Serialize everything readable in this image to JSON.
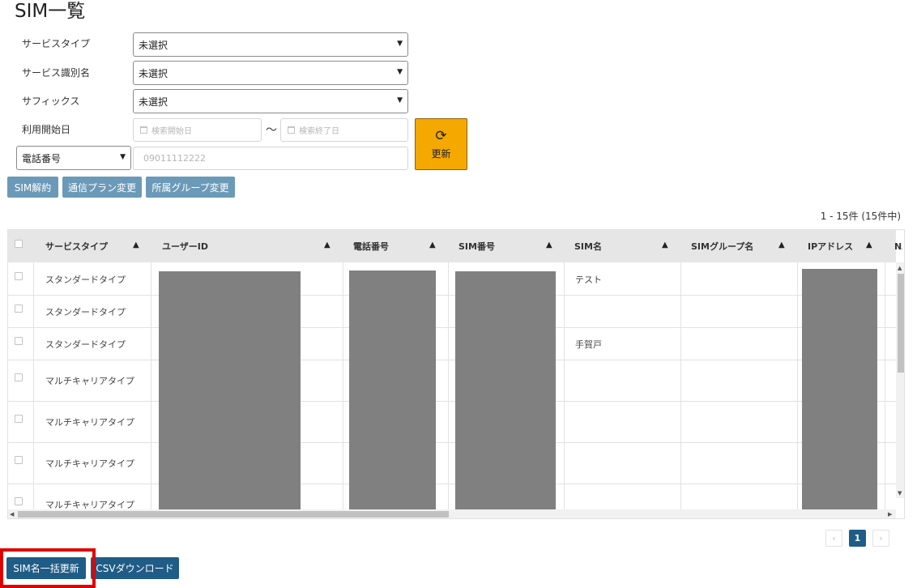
{
  "page_title": "SIM一覧",
  "filters": {
    "service_type": {
      "label": "サービスタイプ",
      "value": "未選択"
    },
    "service_id_name": {
      "label": "サービス識別名",
      "value": "未選択"
    },
    "suffix": {
      "label": "サフィックス",
      "value": "未選択"
    },
    "start_date": {
      "label": "利用開始日",
      "from_placeholder": "検索開始日",
      "separator": "～",
      "to_placeholder": "検索終了日"
    },
    "search_field": {
      "value": "電話番号",
      "placeholder": "09011112222"
    },
    "refresh_label": "更新"
  },
  "actions": {
    "sim_cancel": "SIM解約",
    "plan_change": "通信プラン変更",
    "group_change": "所属グループ変更"
  },
  "count_text": "1 - 15件 (15件中)",
  "table": {
    "headers": [
      "サービスタイプ",
      "ユーザーID",
      "電話番号",
      "SIM番号",
      "SIM名",
      "SIMグループ名",
      "IPアドレス",
      "NA"
    ],
    "rows": [
      {
        "service_type": "スタンダードタイプ",
        "sim_name": "テスト"
      },
      {
        "service_type": "スタンダードタイプ",
        "sim_name": ""
      },
      {
        "service_type": "スタンダードタイプ",
        "sim_name": "手賀戸"
      },
      {
        "service_type": "マルチキャリアタイプ",
        "sim_name": ""
      },
      {
        "service_type": "マルチキャリアタイプ",
        "sim_name": ""
      },
      {
        "service_type": "マルチキャリアタイプ",
        "sim_name": ""
      },
      {
        "service_type": "マルチキャリアタイプ",
        "sim_name": ""
      }
    ]
  },
  "pagination": {
    "prev": "‹",
    "current": "1",
    "next": "›"
  },
  "bottom": {
    "bulk_update": "SIM名一括更新",
    "csv_download": "CSVダウンロード"
  },
  "colors": {
    "accent": "#1f5c86",
    "refresh": "#f5a800",
    "secondary": "#6b9ab8",
    "highlight": "#e00000"
  }
}
